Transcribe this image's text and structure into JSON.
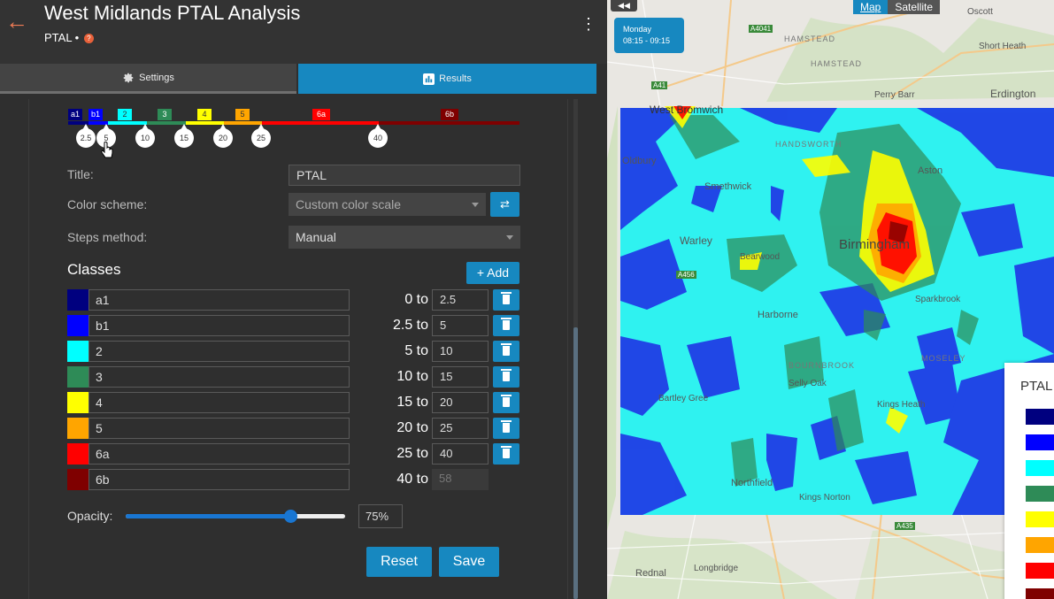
{
  "header": {
    "title": "West Midlands PTAL Analysis",
    "subtitle": "PTAL •",
    "help_glyph": "?",
    "back_icon": "arrow-left-icon",
    "menu_icon": "kebab-menu-icon"
  },
  "tabs": [
    {
      "label": "Settings",
      "icon": "gear-icon",
      "active": false
    },
    {
      "label": "Results",
      "icon": "bar-chart-icon",
      "active": true
    }
  ],
  "legend_bar": {
    "tags": [
      "a1",
      "b1",
      "2",
      "3",
      "4",
      "5",
      "6a",
      "6b"
    ],
    "handles": [
      "2.5",
      "5",
      "10",
      "15",
      "20",
      "25",
      "40"
    ]
  },
  "form": {
    "title_label": "Title:",
    "title_value": "PTAL",
    "color_scheme_label": "Color scheme:",
    "color_scheme_value": "Custom color scale",
    "steps_method_label": "Steps method:",
    "steps_method_value": "Manual"
  },
  "classes": {
    "heading": "Classes",
    "add_label": "+ Add",
    "rows": [
      {
        "name": "a1",
        "from": "0 to",
        "to": "2.5",
        "color": "#00007f"
      },
      {
        "name": "b1",
        "from": "2.5 to",
        "to": "5",
        "color": "#0000ff"
      },
      {
        "name": "2",
        "from": "5 to",
        "to": "10",
        "color": "#00ffff"
      },
      {
        "name": "3",
        "from": "10 to",
        "to": "15",
        "color": "#2e8b57"
      },
      {
        "name": "4",
        "from": "15 to",
        "to": "20",
        "color": "#ffff00"
      },
      {
        "name": "5",
        "from": "20 to",
        "to": "25",
        "color": "#ffa500"
      },
      {
        "name": "6a",
        "from": "25 to",
        "to": "40",
        "color": "#ff0000"
      },
      {
        "name": "6b",
        "from": "40 to",
        "to": "58",
        "color": "#7f0000"
      }
    ]
  },
  "opacity": {
    "label": "Opacity:",
    "value": "75%",
    "percent": 75
  },
  "buttons": {
    "reset": "Reset",
    "save": "Save"
  },
  "map": {
    "collapse_glyph": "◀◀",
    "type_map": "Map",
    "type_satellite": "Satellite",
    "time_day": "Monday",
    "time_range": "08:15 - 09:15",
    "legend_title": "PTAL",
    "labels": {
      "oscott": "Oscott",
      "hamstead1": "HAMSTEAD",
      "hamstead2": "HAMSTEAD",
      "short_heath": "Short Heath",
      "perry_barr": "Perry Barr",
      "erdington": "Erdington",
      "west_bromwich": "West Bromwich",
      "oldbury": "Oldbury",
      "smethwick": "Smethwick",
      "handsworth": "HANDSWORTH",
      "aston": "Aston",
      "warley": "Warley",
      "bearwood": "Bearwood",
      "birmingham": "Birmingham",
      "harborne": "Harborne",
      "sparkbrook": "Sparkbrook",
      "moseley": "MOSELEY",
      "bournbrook": "BOURNBROOK",
      "selly_oak": "Selly Oak",
      "bartley_green": "Bartley Gree",
      "kings_heath": "Kings Heath",
      "northfield": "Northfield",
      "kings_norton": "Kings Norton",
      "rednal": "Rednal",
      "longbridge": "Longbridge",
      "a41": "A41",
      "a4041": "A4041",
      "a435": "A435",
      "a456": "A456"
    }
  }
}
